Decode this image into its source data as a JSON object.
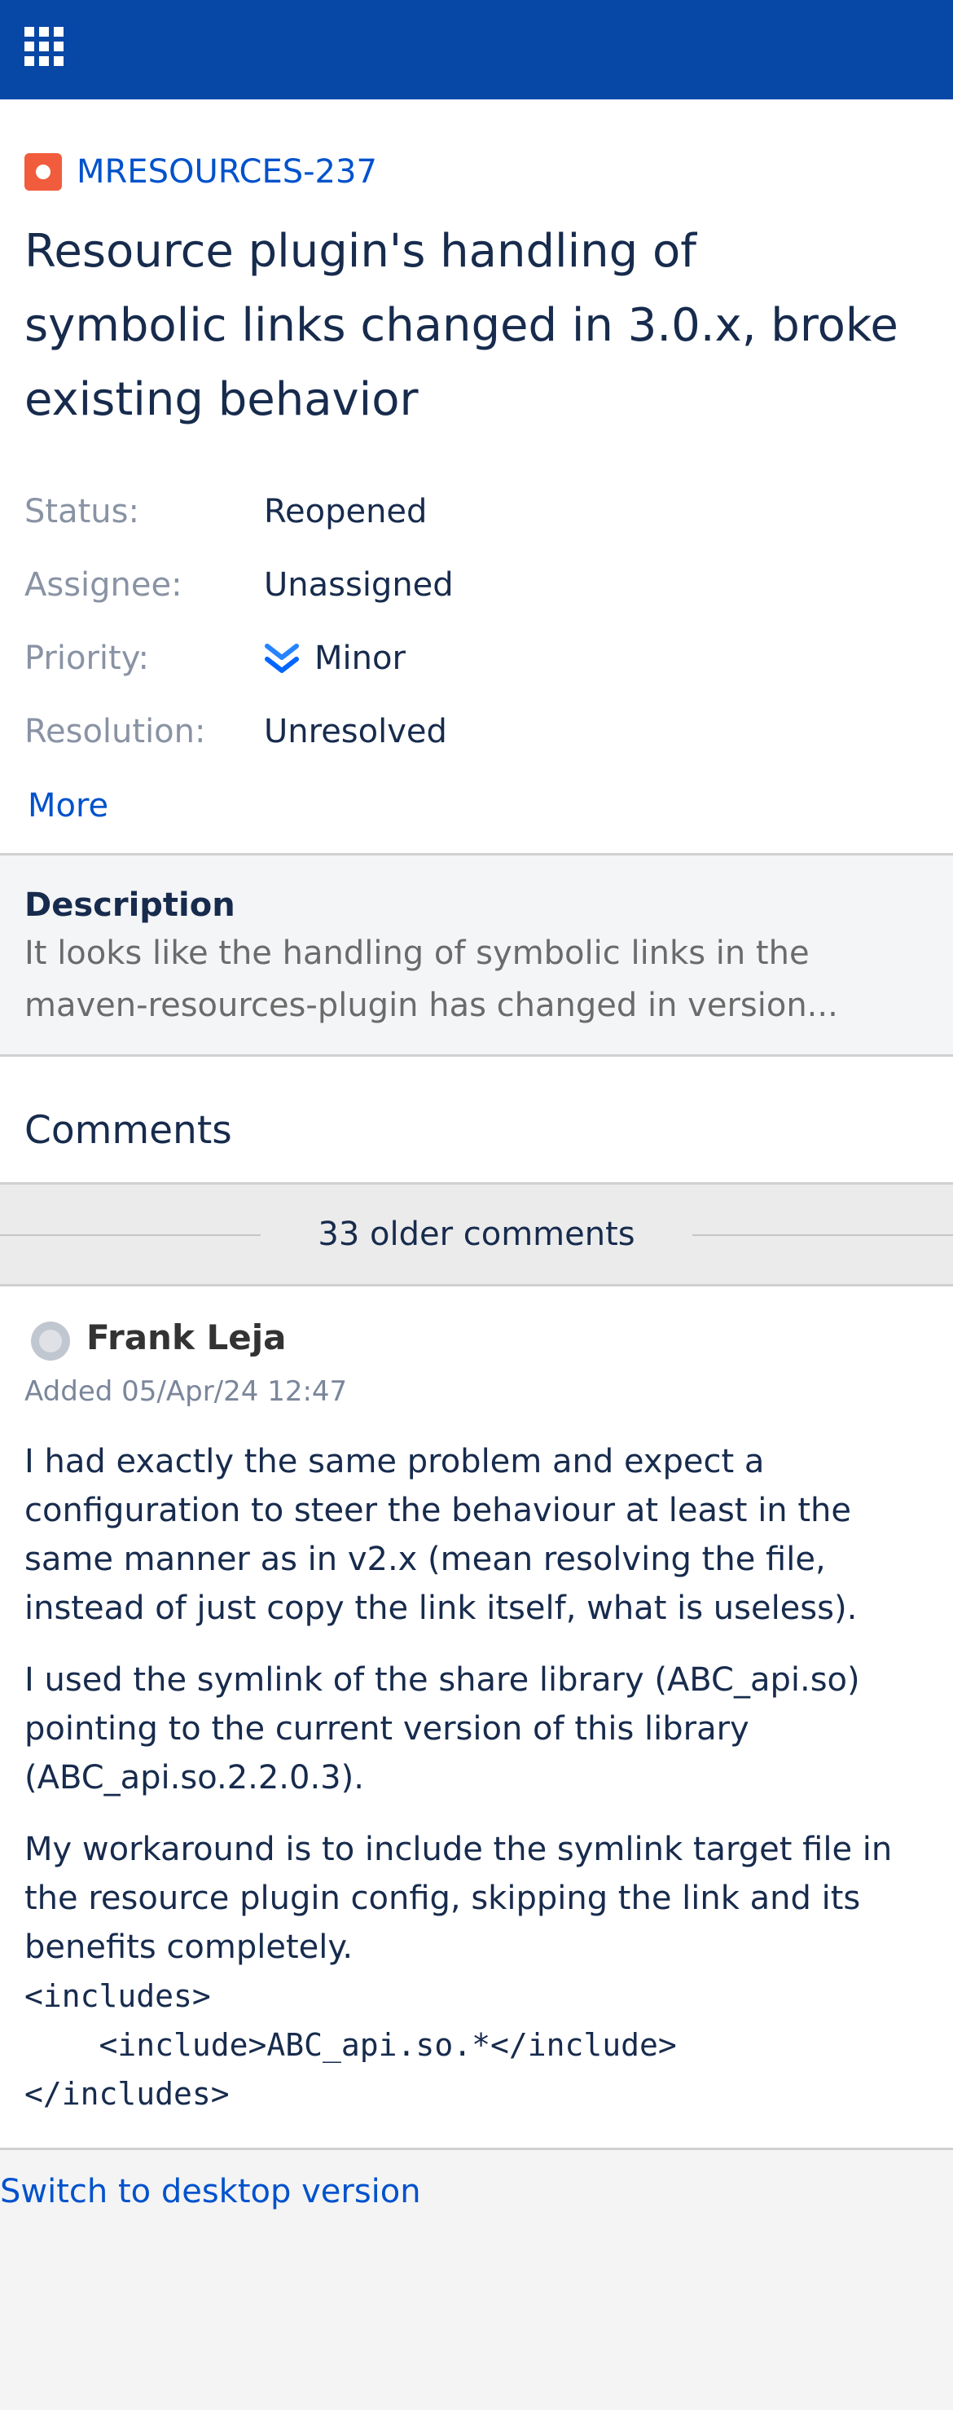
{
  "topbar": {
    "bg_color": "#0747a6",
    "app_switcher_icon": "app-grid-icon"
  },
  "issue": {
    "key": "MRESOURCES-237",
    "type_icon": "bug-icon",
    "type_color": "#f15c3c",
    "title": "Resource plugin's handling of symbolic links changed in 3.0.x, broke existing behavior"
  },
  "fields": {
    "status_label": "Status:",
    "status_value": "Reopened",
    "assignee_label": "Assignee:",
    "assignee_value": "Unassigned",
    "priority_label": "Priority:",
    "priority_value": "Minor",
    "priority_icon": "double-chevron-down-icon",
    "resolution_label": "Resolution:",
    "resolution_value": "Unresolved",
    "more_label": "More"
  },
  "description": {
    "heading": "Description",
    "line1": "It looks like the handling of symbolic links in the",
    "line2": "maven-resources-plugin has changed in version..."
  },
  "comments": {
    "heading": "Comments",
    "older_label": "33 older comments",
    "items": [
      {
        "author": "Frank Leja",
        "date": "Added 05/Apr/24 12:47",
        "p1": "I had exactly the same problem and expect a configuration to steer the behaviour at least in the same manner as in v2.x (mean resolving the file, instead of just copy the link itself, what is useless).",
        "p2": "I used the symlink of the share library (ABC_api.so) pointing to the current version of this library (ABC_api.so.2.2.0.3).",
        "p3": "My workaround is to include the symlink target file in the resource plugin config, skipping the link and its benefits completely.",
        "code1": "<includes>",
        "code2": "    <include>ABC_api.so.*</include>",
        "code3": "</includes>"
      }
    ]
  },
  "footer": {
    "desktop_link": "Switch to desktop version"
  }
}
